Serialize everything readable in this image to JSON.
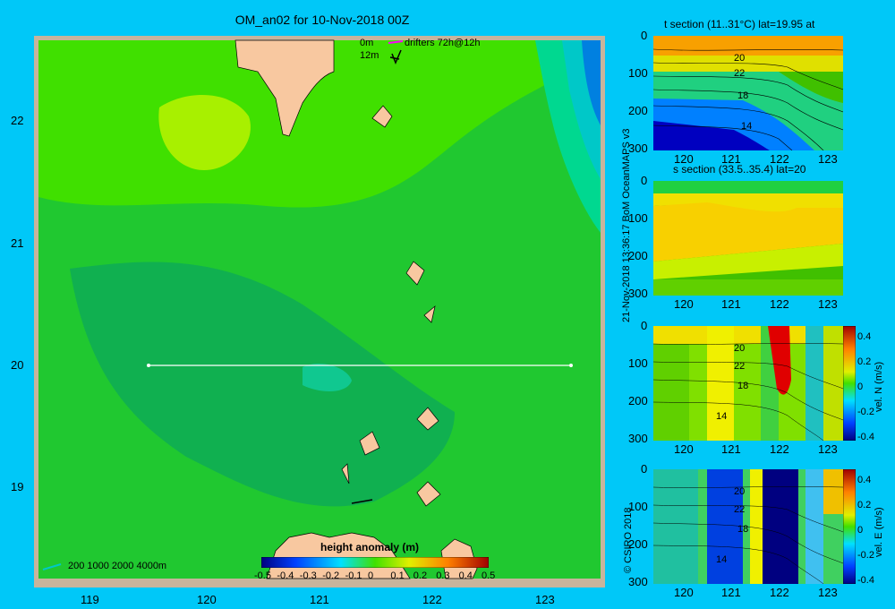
{
  "map": {
    "title": "OM_an02 for 10-Nov-2018 00Z",
    "lat_ticks": [
      "22",
      "21",
      "20",
      "19"
    ],
    "lon_ticks": [
      "119",
      "120",
      "121",
      "122",
      "123"
    ],
    "drifters_label": "drifters 72h@12h",
    "depth_top": "0m",
    "depth_bottom": "12m",
    "scale_label": "200 1000 2000 4000m",
    "section_lat": 20,
    "colorbar": {
      "title": "height anomaly (m)",
      "ticks": [
        "-0.5",
        "-0.4",
        "-0.3",
        "-0.2",
        "-0.1",
        "0",
        "0.1",
        "0.2",
        "0.3",
        "0.4",
        "0.5"
      ]
    }
  },
  "sections": {
    "t_title": "t section (11..31°C) lat=19.95 at",
    "s_title": "s section (33.5..35.4) lat=20",
    "x_ticks": [
      "120",
      "121",
      "122",
      "123"
    ],
    "y_ticks": [
      "0",
      "100",
      "200",
      "300"
    ],
    "contour_labels": [
      "20",
      "22",
      "18",
      "14"
    ],
    "cbar_ticks": [
      "0.4",
      "0.2",
      "0",
      "-0.2",
      "-0.4"
    ],
    "vn_label": "vel. N (m/s)",
    "ve_label": "vel. E (m/s)"
  },
  "credit": {
    "line1": "21-Nov-2018 13:36:17 BoM OceanMAPS v3",
    "line2": "© CSIRO 2018"
  },
  "colors": {
    "background": "#00c8f8",
    "land": "#f8c8a0",
    "frame": "#c8b49c",
    "ocean_base": "#40e000"
  }
}
